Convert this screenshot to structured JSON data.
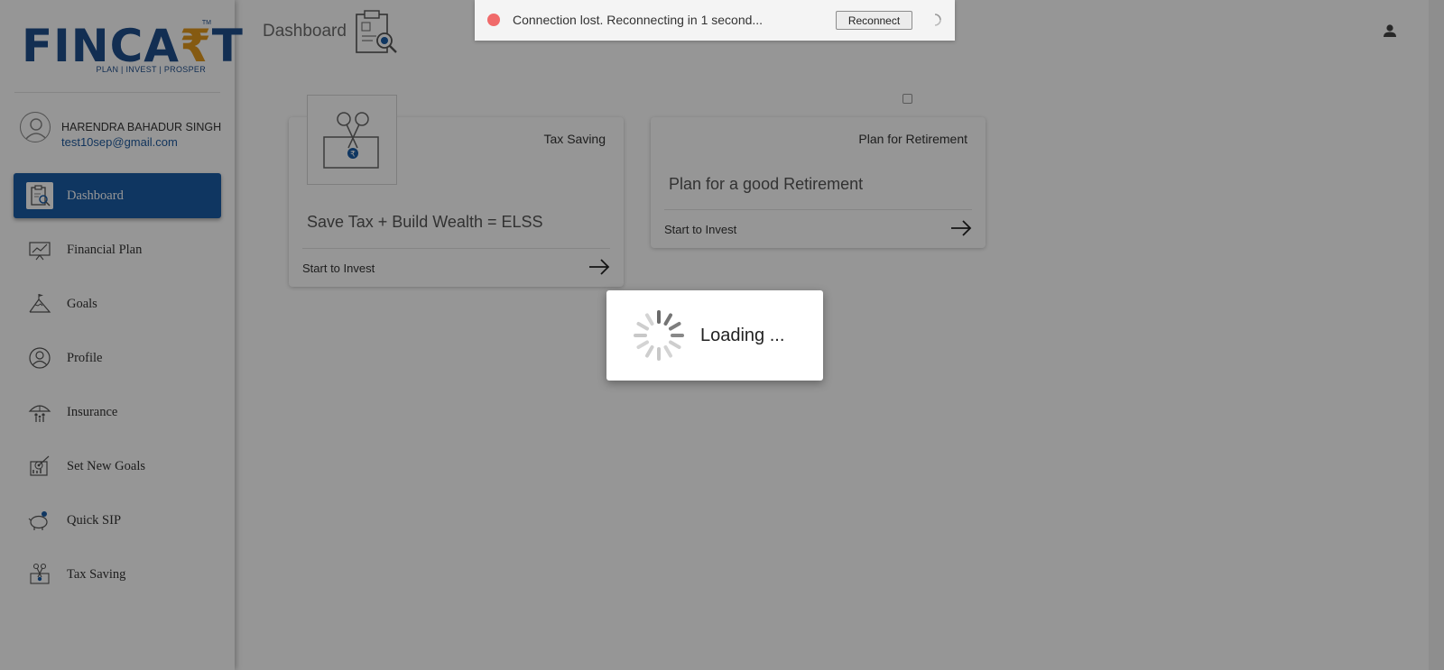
{
  "brand": {
    "logo_left": "FINCA",
    "logo_rupee": "₹",
    "logo_right": "T",
    "trademark": "TM",
    "tagline": "PLAN | INVEST | PROSPER"
  },
  "user": {
    "name": "HARENDRA BAHADUR SINGH",
    "email": "test10sep@gmail.com"
  },
  "sidebar": {
    "items": [
      {
        "label": "Dashboard",
        "icon": "dashboard-icon",
        "active": true
      },
      {
        "label": "Financial Plan",
        "icon": "chart-board-icon"
      },
      {
        "label": "Goals",
        "icon": "mountain-flag-icon"
      },
      {
        "label": "Profile",
        "icon": "profile-icon"
      },
      {
        "label": "Insurance",
        "icon": "umbrella-family-icon"
      },
      {
        "label": "Set New Goals",
        "icon": "target-board-icon"
      },
      {
        "label": "Quick SIP",
        "icon": "piggy-bank-icon"
      },
      {
        "label": "Tax Saving",
        "icon": "scissors-money-icon"
      }
    ]
  },
  "header": {
    "title": "Dashboard"
  },
  "cards": [
    {
      "label": "Tax Saving",
      "text": "Save Tax + Build Wealth = ELSS",
      "action": "Start to Invest"
    },
    {
      "label": "Plan for Retirement",
      "text": "Plan for a good Retirement",
      "action": "Start to Invest"
    }
  ],
  "loading": {
    "text": "Loading  ..."
  },
  "banner": {
    "message": "Connection lost. Reconnecting in 1 second...",
    "button": "Reconnect"
  },
  "colors": {
    "brand_blue": "#1f4e8c",
    "brand_orange": "#e29a1e",
    "active_nav": "#1b5ca6",
    "link_blue": "#1f5a9e",
    "error_dot": "#f06a6a",
    "overlay": "rgba(0,0,0,0.41)"
  }
}
